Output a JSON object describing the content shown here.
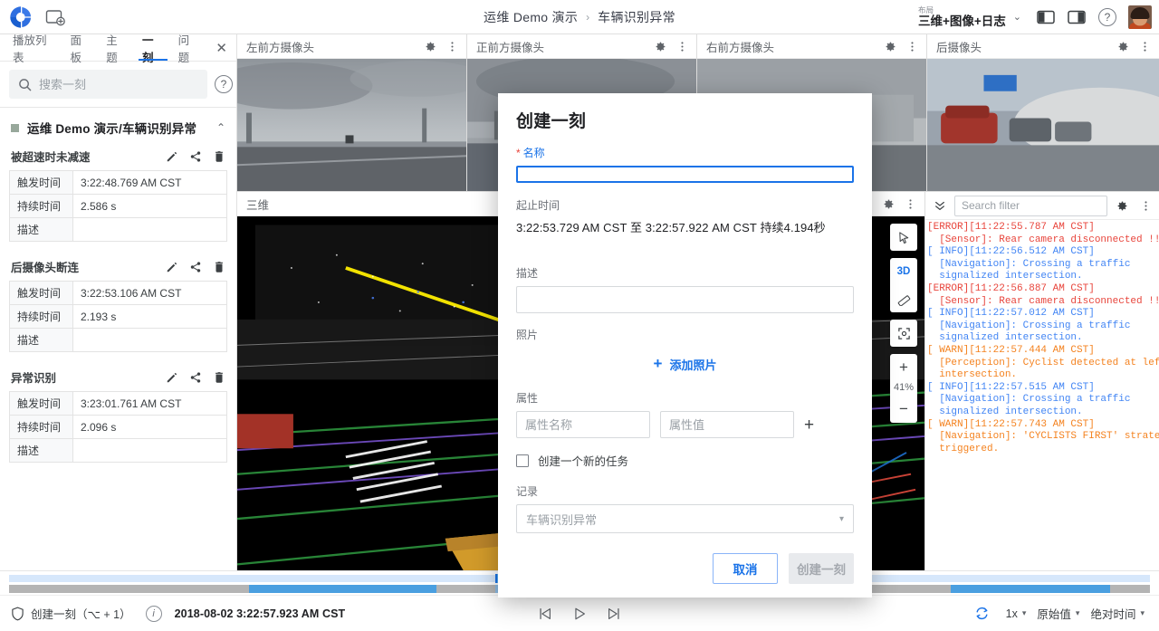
{
  "topbar": {
    "logo_name": "app-logo",
    "add_panel_label": "add-panel",
    "breadcrumb": {
      "root": "运维 Demo 演示",
      "separator": "›",
      "current": "车辆识别异常"
    },
    "layout": {
      "label": "布局",
      "value": "三维+图像+日志"
    },
    "icons": {
      "panel_left": "panel-left-icon",
      "panel_right": "panel-right-icon",
      "help": "?"
    }
  },
  "sidebar": {
    "tabs": [
      {
        "label": "播放列表",
        "active": false
      },
      {
        "label": "面板",
        "active": false
      },
      {
        "label": "主题",
        "active": false
      },
      {
        "label": "一刻",
        "active": true
      },
      {
        "label": "问题",
        "active": false
      }
    ],
    "close_label": "✕",
    "search": {
      "placeholder": "搜索一刻",
      "value": ""
    },
    "help_label": "?",
    "group": {
      "title": "运维 Demo 演示/车辆识别异常",
      "collapse_caret": "⌃"
    },
    "column_labels": {
      "trigger": "触发时间",
      "duration": "持续时间",
      "description": "描述"
    },
    "moments": [
      {
        "name": "被超速时未减速",
        "trigger_time": "3:22:48.769 AM CST",
        "duration": "2.586 s",
        "description": ""
      },
      {
        "name": "后摄像头断连",
        "trigger_time": "3:22:53.106 AM CST",
        "duration": "2.193 s",
        "description": ""
      },
      {
        "name": "异常识别",
        "trigger_time": "3:23:01.761 AM CST",
        "duration": "2.096 s",
        "description": ""
      }
    ],
    "moment_actions": {
      "edit": "edit-icon",
      "share": "share-icon",
      "delete": "delete-icon"
    }
  },
  "camera_panels": [
    {
      "title": "左前方摄像头"
    },
    {
      "title": "正前方摄像头"
    },
    {
      "title": "右前方摄像头"
    },
    {
      "title": "后摄像头"
    }
  ],
  "threed_panel": {
    "title": "三维",
    "toolbar": {
      "cursor": "cursor-icon",
      "mode_label": "3D",
      "ruler": "ruler-icon",
      "focus": "focus-icon",
      "zoom_in": "+",
      "zoom_value": "41%",
      "zoom_out": "−"
    }
  },
  "log_panel": {
    "expand_icon": "chevron-double-down-icon",
    "filter_placeholder": "Search filter",
    "filter_value": "",
    "colors": {
      "error": "#e8453c",
      "info": "#4285f4",
      "warn": "#f4821f"
    },
    "lines": [
      {
        "level": "ERROR",
        "header": "[ERROR][11:22:55.787 AM CST]",
        "body": "  [Sensor]: Rear camera disconnected !!!"
      },
      {
        "level": "INFO",
        "header": "[ INFO][11:22:56.512 AM CST]",
        "body": "  [Navigation]: Crossing a traffic\n  signalized intersection."
      },
      {
        "level": "ERROR",
        "header": "[ERROR][11:22:56.887 AM CST]",
        "body": "  [Sensor]: Rear camera disconnected !!!"
      },
      {
        "level": "INFO",
        "header": "[ INFO][11:22:57.012 AM CST]",
        "body": "  [Navigation]: Crossing a traffic\n  signalized intersection."
      },
      {
        "level": "WARN",
        "header": "[ WARN][11:22:57.444 AM CST]",
        "body": "  [Perception]: Cyclist detected at left\n  intersection."
      },
      {
        "level": "INFO",
        "header": "[ INFO][11:22:57.515 AM CST]",
        "body": "  [Navigation]: Crossing a traffic\n  signalized intersection."
      },
      {
        "level": "WARN",
        "header": "[ WARN][11:22:57.743 AM CST]",
        "body": "  [Navigation]: 'CYCLISTS FIRST' strategy\n  triggered."
      }
    ]
  },
  "timeline": {
    "selection_start_pct": 42.6,
    "selection_end_pct": 64.5,
    "top_segments": [],
    "bottom_segments": [
      {
        "start_pct": 21.0,
        "end_pct": 37.5
      },
      {
        "start_pct": 48.5,
        "end_pct": 63.0
      },
      {
        "start_pct": 82.5,
        "end_pct": 96.5
      }
    ]
  },
  "bottombar": {
    "create_moment": {
      "label": "创建一刻（⌥ + 1）",
      "icon": "shield-icon"
    },
    "info_icon": "info-icon",
    "timestamp": "2018-08-02 3:22:57.923 AM CST",
    "playback": {
      "prev": "skip-previous-icon",
      "play": "play-icon",
      "next": "skip-next-icon"
    },
    "loop_icon": "loop-icon",
    "speed": "1x",
    "value_mode": "原始值",
    "time_mode": "绝对时间",
    "caret": "▾"
  },
  "modal": {
    "title": "创建一刻",
    "name": {
      "label": "名称",
      "required_mark": "*",
      "value": "",
      "placeholder": ""
    },
    "range": {
      "label": "起止时间",
      "text": "3:22:53.729 AM CST 至 3:22:57.922 AM CST 持续4.194秒"
    },
    "description": {
      "label": "描述",
      "value": "",
      "placeholder": ""
    },
    "photos": {
      "label": "照片",
      "add_label": "添加照片",
      "add_icon": "+"
    },
    "attributes": {
      "label": "属性",
      "name_placeholder": "属性名称",
      "value_placeholder": "属性值",
      "name_value": "",
      "value_value": "",
      "add_icon": "+"
    },
    "create_task": {
      "label": "创建一个新的任务",
      "checked": false
    },
    "record": {
      "label": "记录",
      "value": "车辆识别异常",
      "caret": "▾"
    },
    "buttons": {
      "cancel": "取消",
      "create": "创建一刻"
    }
  }
}
